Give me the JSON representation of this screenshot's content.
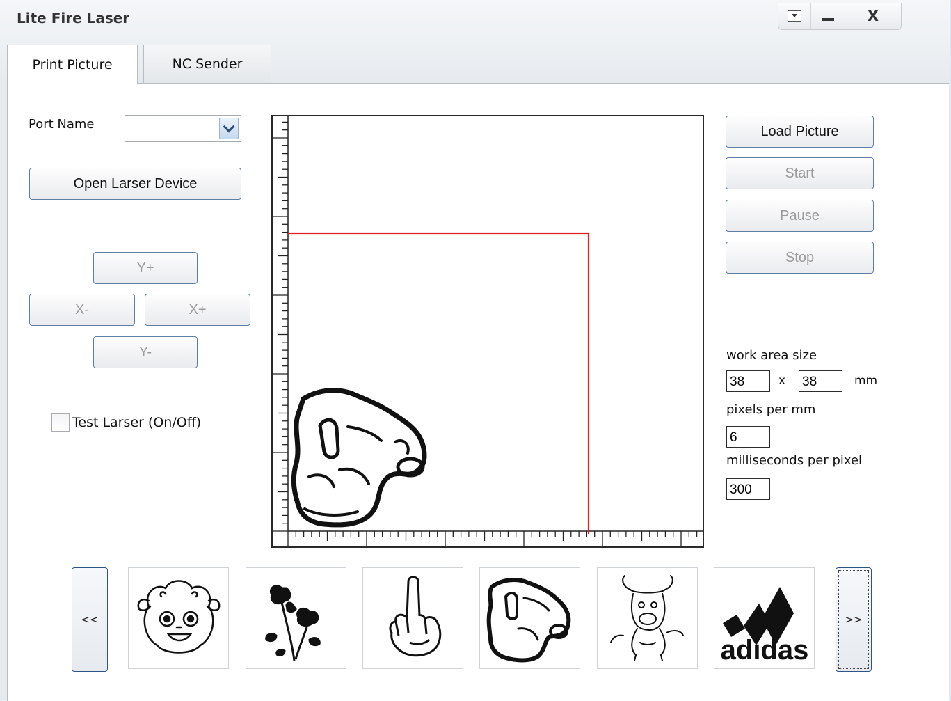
{
  "window": {
    "title": "Lite Fire Laser",
    "close_glyph": "X",
    "icons": [
      "dropdown-icon",
      "minimize-icon",
      "close-icon"
    ]
  },
  "tabs": [
    {
      "label": "Print Picture",
      "active": true
    },
    {
      "label": "NC Sender",
      "active": false
    }
  ],
  "left": {
    "port_name_label": "Port Name",
    "port_name_value": "",
    "open_button": "Open Larser Device",
    "y_plus": "Y+",
    "x_minus": "X-",
    "x_plus": "X+",
    "y_minus": "Y-",
    "test_laser_label": "Test Larser (On/Off)",
    "test_laser_checked": false
  },
  "right": {
    "load_picture": "Load Picture",
    "start": "Start",
    "pause": "Pause",
    "stop": "Stop",
    "work_area_label": "work area size",
    "work_area_w": "38",
    "work_area_x": "x",
    "work_area_h": "38",
    "work_area_unit": "mm",
    "pixels_per_mm_label": "pixels per mm",
    "pixels_per_mm": "6",
    "ms_per_pixel_label": "milliseconds per pixel",
    "ms_per_pixel": "300"
  },
  "gallery": {
    "prev": "<<",
    "next": ">>",
    "thumbnails": [
      "sheep-cartoon-image",
      "rose-image",
      "middle-finger-hand-image",
      "pointing-hand-image",
      "bull-cartoon-image",
      "adidas-logo-image"
    ],
    "adidas_text": "adidas"
  },
  "colors": {
    "work_area_outline": "#e02020",
    "accent_border": "#2d5584"
  }
}
